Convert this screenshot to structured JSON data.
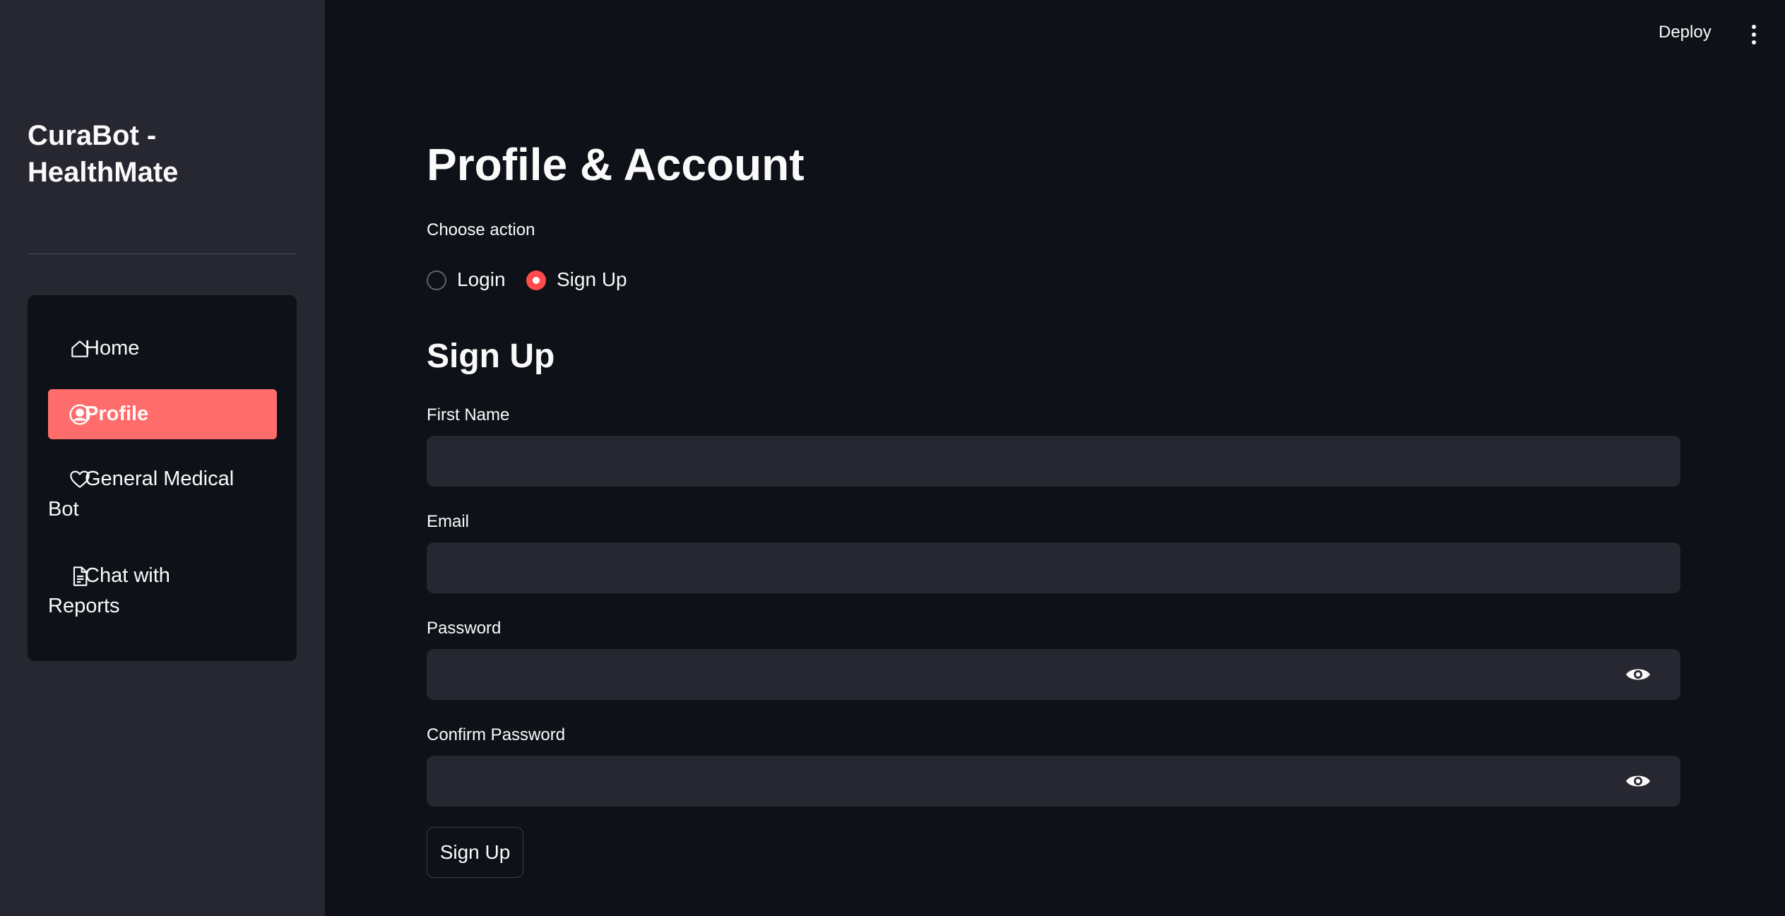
{
  "sidebar": {
    "brand_line1": "CuraBot -",
    "brand_line2": "HealthMate",
    "items": [
      {
        "label": "Home",
        "icon": "home-icon"
      },
      {
        "label": "Profile",
        "icon": "user-circle-icon",
        "active": true
      },
      {
        "label_line1": "General Medical",
        "label_line2": "Bot",
        "icon": "heart-icon"
      },
      {
        "label_line1": "Chat with",
        "label_line2": "Reports",
        "icon": "document-icon"
      }
    ]
  },
  "header": {
    "deploy_label": "Deploy",
    "menu_icon": "more-vertical-icon"
  },
  "main": {
    "title": "Profile & Account",
    "choose_action_label": "Choose action",
    "radio_options": [
      {
        "label": "Login",
        "checked": false
      },
      {
        "label": "Sign Up",
        "checked": true
      }
    ],
    "section_title": "Sign Up",
    "fields": {
      "first_name": {
        "label": "First Name",
        "value": ""
      },
      "email": {
        "label": "Email",
        "value": ""
      },
      "password": {
        "label": "Password",
        "value": ""
      },
      "confirm_password": {
        "label": "Confirm Password",
        "value": ""
      }
    },
    "submit_label": "Sign Up"
  },
  "colors": {
    "background": "#0e1117",
    "sidebar": "#262730",
    "accent": "#ff4b4b",
    "active_nav": "#ff6c6c",
    "input_bg": "#262730"
  }
}
